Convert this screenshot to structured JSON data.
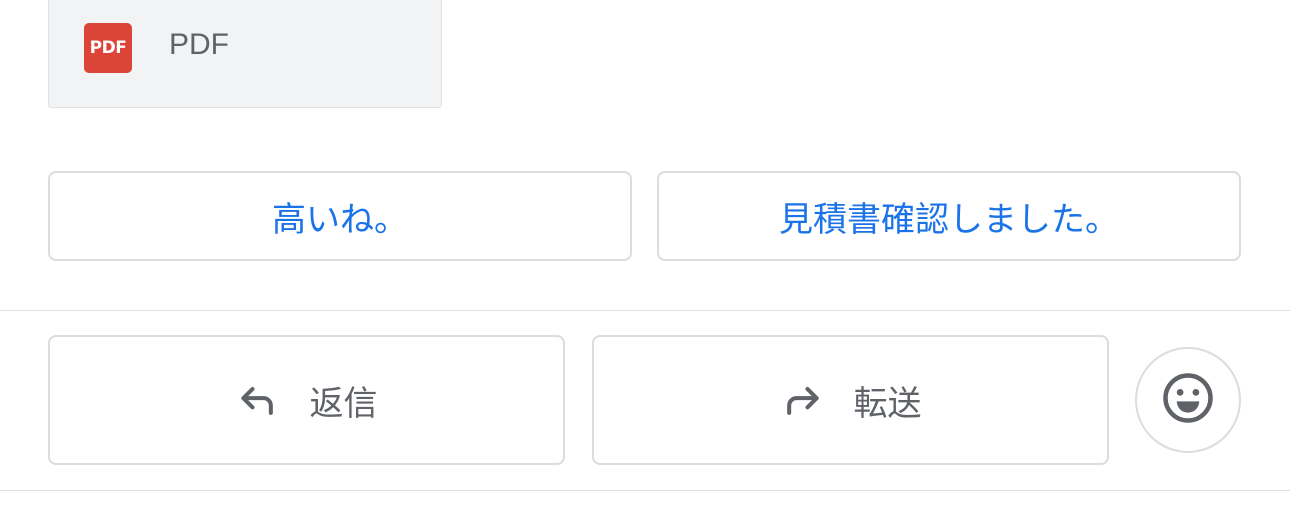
{
  "attachment": {
    "icon_label": "PDF",
    "name": "PDF",
    "icon_name": "pdf-icon",
    "icon_color": "#db4437"
  },
  "smart_replies": [
    {
      "label": "高いね。"
    },
    {
      "label": "見積書確認しました。"
    }
  ],
  "actions": {
    "reply": {
      "label": "返信",
      "icon_name": "reply-icon"
    },
    "forward": {
      "label": "転送",
      "icon_name": "forward-icon"
    },
    "emoji": {
      "icon_name": "smiley-icon"
    }
  },
  "colors": {
    "accent": "#1a73e8",
    "text_secondary": "#5f6368",
    "border": "#dadce0"
  }
}
